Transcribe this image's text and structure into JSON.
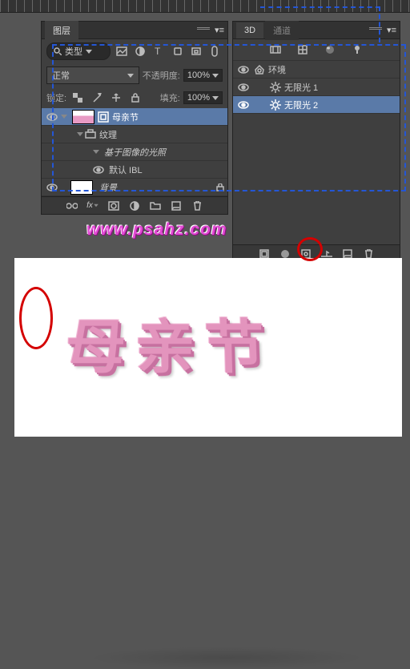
{
  "ruler": {},
  "layersPanel": {
    "tab": "图层",
    "searchMode": "类型",
    "blend": "正常",
    "opacityLabel": "不透明度:",
    "opacity": "100%",
    "lockLabel": "锁定:",
    "fillLabel": "填充:",
    "fill": "100%",
    "layers": [
      {
        "name": "母亲节",
        "selected": true,
        "thumb": "pink"
      },
      {
        "name": "纹理",
        "indent": 1
      },
      {
        "name": "基于图像的光照",
        "indent": 2,
        "italic": true
      },
      {
        "name": "默认 IBL",
        "indent": 2,
        "eye": true
      },
      {
        "name": "背景",
        "thumb": "white",
        "italic": true,
        "eye": true
      }
    ]
  },
  "threedPanel": {
    "tab1": "3D",
    "tab2": "通道",
    "items": [
      {
        "name": "环境",
        "icon": "env"
      },
      {
        "name": "无限光 1",
        "icon": "light"
      },
      {
        "name": "无限光 2",
        "icon": "light",
        "selected": true
      }
    ]
  },
  "watermark": "www.psahz.com",
  "preview_text": "母亲节"
}
